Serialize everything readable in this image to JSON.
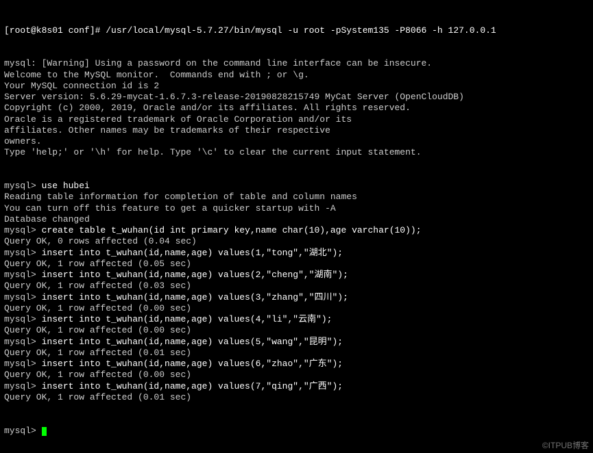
{
  "shell_prompt": "[root@k8s01 conf]# ",
  "first_command": "/usr/local/mysql-5.7.27/bin/mysql -u root -pSystem135 -P8066 -h 127.0.0.1",
  "banner": [
    "mysql: [Warning] Using a password on the command line interface can be insecure.",
    "Welcome to the MySQL monitor.  Commands end with ; or \\g.",
    "Your MySQL connection id is 2",
    "Server version: 5.6.29-mycat-1.6.7.3-release-20190828215749 MyCat Server (OpenCloudDB)",
    "",
    "Copyright (c) 2000, 2019, Oracle and/or its affiliates. All rights reserved.",
    "",
    "Oracle is a registered trademark of Oracle Corporation and/or its",
    "affiliates. Other names may be trademarks of their respective",
    "owners.",
    "",
    "Type 'help;' or '\\h' for help. Type '\\c' to clear the current input statement.",
    ""
  ],
  "mysql_prompt": "mysql> ",
  "session": [
    {
      "cmd": "use hubei",
      "out": [
        "Reading table information for completion of table and column names",
        "You can turn off this feature to get a quicker startup with -A",
        "",
        "Database changed"
      ]
    },
    {
      "cmd": "create table t_wuhan(id int primary key,name char(10),age varchar(10));",
      "out": [
        "Query OK, 0 rows affected (0.04 sec)",
        ""
      ]
    },
    {
      "cmd": "insert into t_wuhan(id,name,age) values(1,\"tong\",\"湖北\");",
      "out": [
        "Query OK, 1 row affected (0.05 sec)",
        ""
      ]
    },
    {
      "cmd": "insert into t_wuhan(id,name,age) values(2,\"cheng\",\"湖南\");",
      "out": [
        "Query OK, 1 row affected (0.03 sec)",
        ""
      ]
    },
    {
      "cmd": "insert into t_wuhan(id,name,age) values(3,\"zhang\",\"四川\");",
      "out": [
        "Query OK, 1 row affected (0.00 sec)",
        ""
      ]
    },
    {
      "cmd": "insert into t_wuhan(id,name,age) values(4,\"li\",\"云南\");",
      "out": [
        "Query OK, 1 row affected (0.00 sec)",
        ""
      ]
    },
    {
      "cmd": "insert into t_wuhan(id,name,age) values(5,\"wang\",\"昆明\");",
      "out": [
        "Query OK, 1 row affected (0.01 sec)",
        ""
      ]
    },
    {
      "cmd": "insert into t_wuhan(id,name,age) values(6,\"zhao\",\"广东\");",
      "out": [
        "Query OK, 1 row affected (0.00 sec)",
        ""
      ]
    },
    {
      "cmd": "insert into t_wuhan(id,name,age) values(7,\"qing\",\"广西\");",
      "out": [
        "Query OK, 1 row affected (0.01 sec)",
        ""
      ]
    }
  ],
  "final_prompt": "mysql> ",
  "watermark": "©ITPUB博客"
}
